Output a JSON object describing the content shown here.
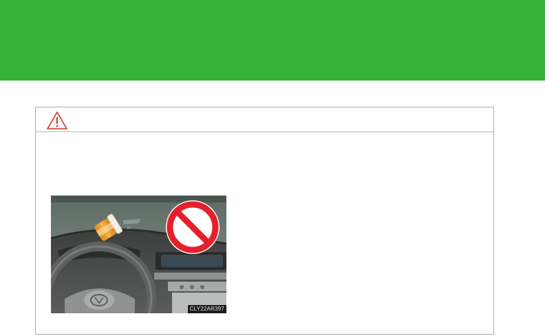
{
  "header": {
    "banner_color": "#36b336"
  },
  "caution": {
    "icon": "warning-triangle-icon",
    "icon_color": "#c0392b",
    "photo": {
      "description_icons": [
        "pill-bottle-icon",
        "prohibited-icon",
        "steering-wheel-icon"
      ],
      "code": "CLY22AR397"
    }
  }
}
